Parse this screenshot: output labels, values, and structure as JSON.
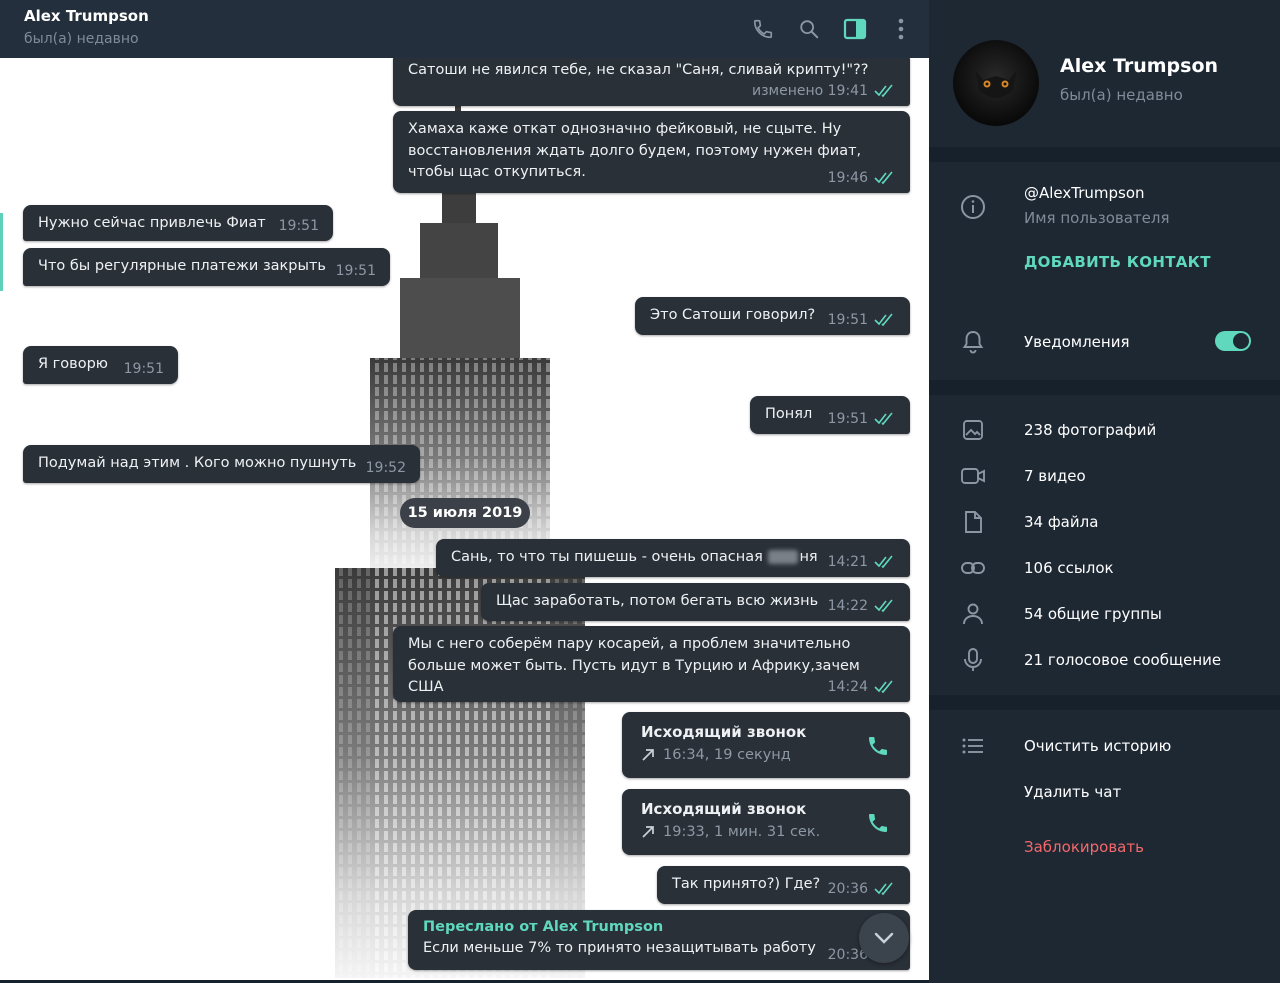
{
  "header": {
    "name": "Alex Trumpson",
    "status": "был(а) недавно"
  },
  "messages": [
    {
      "id": "m1",
      "dir": "out",
      "text": "Сатоши не явился тебе, не сказал \"Саня, сливай крипту!\"??",
      "time": "изменено 19:41"
    },
    {
      "id": "m2",
      "dir": "out",
      "text": "Хамаха каже откат однозначно фейковый, не сцыте. Ну восстановления ждать долго будем, поэтому нужен фиат, чтобы щас откупиться.",
      "time": "19:46"
    },
    {
      "id": "m3",
      "dir": "in",
      "text": "Нужно сейчас привлечь Фиат",
      "time": "19:51"
    },
    {
      "id": "m4",
      "dir": "in",
      "text": "Что бы регулярные платежи закрыть",
      "time": "19:51"
    },
    {
      "id": "m5",
      "dir": "out",
      "text": "Это Сатоши говорил?",
      "time": "19:51"
    },
    {
      "id": "m6",
      "dir": "in",
      "text": "Я говорю",
      "time": "19:51"
    },
    {
      "id": "m7",
      "dir": "out",
      "text": "Понял",
      "time": "19:51"
    },
    {
      "id": "m8",
      "dir": "in",
      "text": "Подумай над этим . Кого можно пушнуть",
      "time": "19:52"
    },
    {
      "id": "m9",
      "dir": "out",
      "text_before": "Сань, то что ты пишешь - очень опасная",
      "text_after": "ня",
      "time": "14:21"
    },
    {
      "id": "m10",
      "dir": "out",
      "text": "Щас заработать, потом бегать всю жизнь",
      "time": "14:22"
    },
    {
      "id": "m11",
      "dir": "out",
      "text": "Мы с него соберём пару косарей, а проблем значительно больше может быть. Пусть идут в Турцию и Африку,зачем США",
      "time": "14:24"
    },
    {
      "id": "m14",
      "dir": "out",
      "text": "Так принято?) Где?",
      "time": "20:36"
    }
  ],
  "date_divider": "15 июля 2019",
  "calls": [
    {
      "title": "Исходящий звонок",
      "details": "16:34, 19 секунд"
    },
    {
      "title": "Исходящий звонок",
      "details": "19:33, 1 мин. 31 сек."
    }
  ],
  "forwarded": {
    "from": "Переслано от Alex Trumpson",
    "text": "Если меньше 7% то принято незащитывать работу",
    "time": "20:36"
  },
  "profile": {
    "name": "Alex Trumpson",
    "status": "был(а) недавно",
    "username": "@AlexTrumpson",
    "username_caption": "Имя пользователя",
    "add_contact": "ДОБАВИТЬ КОНТАКТ",
    "notifications_label": "Уведомления",
    "notifications_on": true
  },
  "media": [
    {
      "icon": "photo-icon",
      "label": "238 фотографий"
    },
    {
      "icon": "video-icon",
      "label": "7 видео"
    },
    {
      "icon": "file-icon",
      "label": "34 файла"
    },
    {
      "icon": "link-icon",
      "label": "106 ссылок"
    },
    {
      "icon": "group-icon",
      "label": "54 общие группы"
    },
    {
      "icon": "microphone-icon",
      "label": "21 голосовое сообщение"
    }
  ],
  "actions": {
    "clear_history": "Очистить историю",
    "delete_chat": "Удалить чат",
    "block": "Заблокировать"
  },
  "colors": {
    "accent": "#5fd8bd",
    "danger": "#f4686b",
    "panel": "#1e2833",
    "bubble": "#2a3038"
  }
}
